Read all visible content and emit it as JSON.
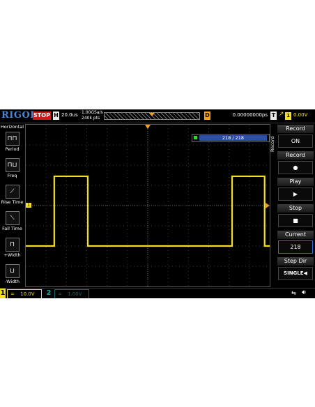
{
  "header": {
    "brand": "RIGOL",
    "run_state": "STOP",
    "horizontal_badge": "H",
    "timebase": "20.0us",
    "sample_rate": "1.00GSa/s",
    "memory_depth": "240k pts",
    "delay_badge": "D",
    "delay_value": "0.00000000ps",
    "trigger_badge": "T",
    "trigger_source": "1",
    "trigger_level": "0.00V"
  },
  "left_panel": {
    "title": "Horizontal",
    "items": [
      {
        "label": "Period",
        "icon": "period-icon"
      },
      {
        "label": "Freq",
        "icon": "frequency-icon"
      },
      {
        "label": "Rise Time",
        "icon": "rise-time-icon"
      },
      {
        "label": "Fall Time",
        "icon": "fall-time-icon"
      },
      {
        "label": "+Width",
        "icon": "positive-width-icon"
      },
      {
        "label": "-Width",
        "icon": "negative-width-icon"
      }
    ]
  },
  "navigator": {
    "frame_counter": "218 / 218"
  },
  "right_menu": {
    "side_label": "Record",
    "sections": [
      {
        "title": "Record",
        "value": "ON"
      },
      {
        "title": "Record",
        "value": "●"
      },
      {
        "title": "Play",
        "value": "▶"
      },
      {
        "title": "Stop",
        "value": "■"
      },
      {
        "title": "Current",
        "value": "218"
      },
      {
        "title": "Step Dir",
        "value": "SINGLE◀"
      }
    ]
  },
  "channels": {
    "ch1": {
      "number": "1",
      "coupling": "=",
      "scale": "10.0V",
      "color": "#f2e020"
    },
    "ch2": {
      "number": "2",
      "coupling": "=",
      "scale": "1.00V",
      "color": "#1fa4a4"
    }
  },
  "waveform": {
    "type": "square",
    "channel": "1",
    "high_level_divisions": 1.45,
    "low_level_divisions": -2.0,
    "rising_edges_divisions": [
      -4.6,
      4.15
    ],
    "falling_edges_divisions": [
      -2.95,
      5.75
    ],
    "color": "#f2e020"
  },
  "icons": {
    "usb": "usb-icon",
    "speaker": "speaker-icon"
  }
}
